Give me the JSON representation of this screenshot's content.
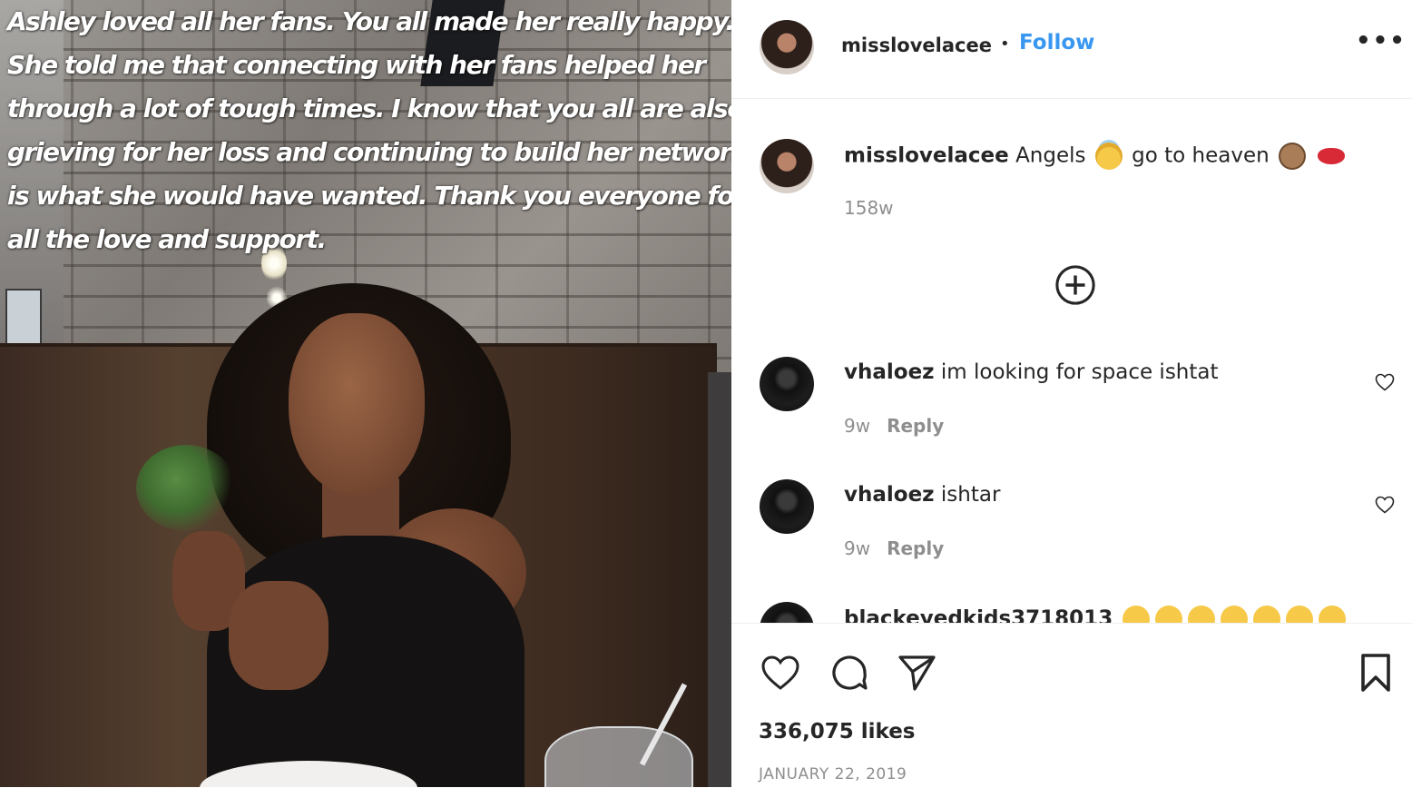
{
  "photo": {
    "caption_lines": [
      "Ashley loved all her fans. You all made her really happy.",
      "She told me that connecting with her fans helped her",
      "through a lot of tough times. I know that you all are also",
      "grieving for her loss and continuing to build her network",
      "is what she would have wanted. Thank you everyone for",
      "all the love and support."
    ]
  },
  "header": {
    "username": "misslovelacee",
    "separator": "•",
    "follow_label": "Follow",
    "more_label": "•••"
  },
  "caption": {
    "username": "misslovelacee",
    "text_before": "Angels",
    "text_after": "go to heaven",
    "time": "158w",
    "emoji_icons": [
      "angel-face-icon",
      "clapping-hands-icon",
      "kiss-lips-icon"
    ]
  },
  "load_more_icon": "plus-circle-icon",
  "comments": [
    {
      "username": "vhaloez",
      "text": "im looking for space ishtat",
      "time": "9w",
      "reply_label": "Reply"
    },
    {
      "username": "vhaloez",
      "text": "ishtar",
      "time": "9w",
      "reply_label": "Reply"
    },
    {
      "username": "blackeyedkids3718013",
      "text": "",
      "time": "",
      "reply_label": ""
    }
  ],
  "actions": {
    "like_icon": "heart-icon",
    "comment_icon": "comment-bubble-icon",
    "share_icon": "paper-plane-icon",
    "save_icon": "bookmark-icon"
  },
  "likes": "336,075 likes",
  "date": "JANUARY 22, 2019",
  "colors": {
    "link": "#3897f0",
    "text": "#262626",
    "muted": "#8e8e8e",
    "divider": "#efefef"
  }
}
